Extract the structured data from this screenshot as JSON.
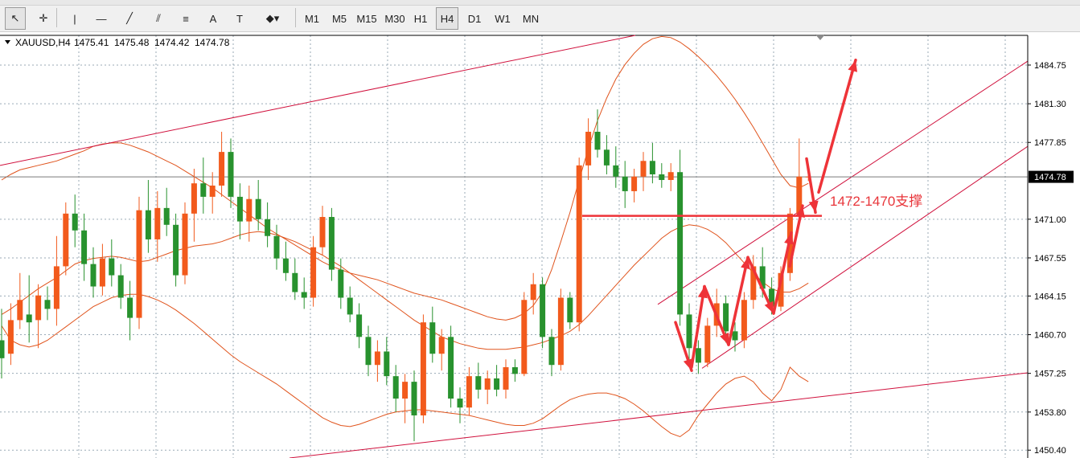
{
  "toolbar": {
    "tools": [
      {
        "name": "cursor-tool",
        "glyph": "↖"
      },
      {
        "name": "crosshair-tool",
        "glyph": "✛"
      },
      {
        "name": "vertical-line-tool",
        "glyph": "|"
      },
      {
        "name": "horizontal-line-tool",
        "glyph": "—"
      },
      {
        "name": "trendline-tool",
        "glyph": "╱"
      },
      {
        "name": "equidistant-channel-tool",
        "glyph": "⫽"
      },
      {
        "name": "fibonacci-tool",
        "glyph": "≡"
      },
      {
        "name": "text-tool",
        "glyph": "A"
      },
      {
        "name": "text-label-tool",
        "glyph": "T"
      },
      {
        "name": "shapes-menu-tool",
        "glyph": "◆▾"
      }
    ],
    "timeframes": [
      "M1",
      "M5",
      "M15",
      "M30",
      "H1",
      "H4",
      "D1",
      "W1",
      "MN"
    ],
    "active_timeframe": "H4"
  },
  "header": {
    "symbol": "XAUUSD,H4",
    "open": "1475.41",
    "high": "1475.48",
    "low": "1474.42",
    "close": "1474.78"
  },
  "colors": {
    "bull": "#f25a1c",
    "bear": "#28922e",
    "band": "#e0541d",
    "channel": "#d0103c",
    "annotation": "#ee3338",
    "grid": "#9aaab6"
  },
  "chart_data": {
    "type": "candlestick",
    "symbol": "XAUUSD",
    "timeframe": "H4",
    "y_tick_labels": [
      "1484.75",
      "1481.30",
      "1477.85",
      "1474.78",
      "1471.00",
      "1467.55",
      "1464.15",
      "1460.70",
      "1457.25",
      "1453.80",
      "1450.40"
    ],
    "ylim": [
      1449.7,
      1487.4
    ],
    "current_price": "1474.78",
    "annotation_text": "1472-1470支撑",
    "support_level": 1471.3,
    "candles": [
      [
        1460.2,
        1463.0,
        1456.8,
        1458.6
      ],
      [
        1459.0,
        1463.5,
        1458.0,
        1462.0
      ],
      [
        1462.0,
        1466.2,
        1461.2,
        1463.8
      ],
      [
        1462.5,
        1466.0,
        1460.0,
        1461.8
      ],
      [
        1462.0,
        1465.2,
        1459.5,
        1464.2
      ],
      [
        1463.8,
        1465.0,
        1462.0,
        1463.0
      ],
      [
        1463.0,
        1469.5,
        1461.5,
        1466.8
      ],
      [
        1466.8,
        1472.5,
        1466.0,
        1471.5
      ],
      [
        1471.5,
        1473.2,
        1468.5,
        1470.0
      ],
      [
        1470.0,
        1471.5,
        1465.5,
        1467.0
      ],
      [
        1467.0,
        1468.5,
        1464.0,
        1465.0
      ],
      [
        1465.0,
        1468.8,
        1464.2,
        1467.5
      ],
      [
        1467.5,
        1469.2,
        1465.0,
        1466.0
      ],
      [
        1466.0,
        1467.0,
        1463.0,
        1464.0
      ],
      [
        1464.0,
        1465.5,
        1460.2,
        1462.2
      ],
      [
        1462.2,
        1473.0,
        1461.2,
        1471.8
      ],
      [
        1471.8,
        1474.5,
        1468.0,
        1469.2
      ],
      [
        1469.2,
        1473.5,
        1467.2,
        1472.0
      ],
      [
        1472.0,
        1473.8,
        1469.5,
        1470.5
      ],
      [
        1470.5,
        1471.5,
        1465.0,
        1466.0
      ],
      [
        1466.0,
        1472.5,
        1465.2,
        1471.5
      ],
      [
        1471.5,
        1475.5,
        1469.0,
        1474.2
      ],
      [
        1474.2,
        1476.5,
        1471.5,
        1473.0
      ],
      [
        1473.0,
        1475.2,
        1471.5,
        1474.0
      ],
      [
        1474.0,
        1478.8,
        1473.0,
        1477.0
      ],
      [
        1477.0,
        1478.2,
        1472.0,
        1473.0
      ],
      [
        1473.0,
        1474.2,
        1469.2,
        1470.8
      ],
      [
        1470.8,
        1474.0,
        1469.0,
        1472.8
      ],
      [
        1472.8,
        1474.5,
        1470.0,
        1471.0
      ],
      [
        1471.0,
        1472.5,
        1468.5,
        1469.5
      ],
      [
        1469.5,
        1470.5,
        1466.5,
        1467.5
      ],
      [
        1467.5,
        1469.0,
        1465.5,
        1466.2
      ],
      [
        1466.2,
        1467.5,
        1463.8,
        1464.5
      ],
      [
        1464.5,
        1465.8,
        1463.0,
        1464.0
      ],
      [
        1464.0,
        1469.5,
        1463.2,
        1468.5
      ],
      [
        1468.5,
        1472.2,
        1467.8,
        1471.2
      ],
      [
        1471.2,
        1472.0,
        1465.5,
        1466.5
      ],
      [
        1466.5,
        1467.5,
        1463.0,
        1464.0
      ],
      [
        1464.0,
        1465.0,
        1461.8,
        1462.5
      ],
      [
        1462.5,
        1463.5,
        1459.5,
        1460.5
      ],
      [
        1460.5,
        1461.5,
        1457.0,
        1458.0
      ],
      [
        1458.0,
        1460.2,
        1456.5,
        1459.2
      ],
      [
        1459.2,
        1460.5,
        1456.2,
        1457.0
      ],
      [
        1457.0,
        1458.0,
        1453.8,
        1455.0
      ],
      [
        1455.0,
        1457.2,
        1452.8,
        1456.5
      ],
      [
        1456.5,
        1457.5,
        1451.2,
        1453.5
      ],
      [
        1453.5,
        1462.5,
        1452.8,
        1461.8
      ],
      [
        1461.8,
        1463.2,
        1458.2,
        1459.0
      ],
      [
        1459.0,
        1461.2,
        1457.5,
        1460.5
      ],
      [
        1460.5,
        1461.5,
        1454.2,
        1455.0
      ],
      [
        1455.0,
        1456.0,
        1452.8,
        1454.2
      ],
      [
        1454.2,
        1457.8,
        1453.5,
        1457.0
      ],
      [
        1457.0,
        1458.2,
        1455.0,
        1455.8
      ],
      [
        1455.8,
        1457.5,
        1454.5,
        1456.8
      ],
      [
        1456.8,
        1458.0,
        1455.2,
        1455.8
      ],
      [
        1455.8,
        1458.5,
        1455.0,
        1457.8
      ],
      [
        1457.8,
        1458.5,
        1456.5,
        1457.2
      ],
      [
        1457.2,
        1464.5,
        1457.0,
        1463.8
      ],
      [
        1463.8,
        1466.2,
        1462.5,
        1465.2
      ],
      [
        1465.2,
        1465.8,
        1459.5,
        1460.5
      ],
      [
        1460.5,
        1461.2,
        1457.0,
        1458.0
      ],
      [
        1458.0,
        1464.8,
        1457.5,
        1464.0
      ],
      [
        1464.0,
        1464.5,
        1461.2,
        1461.8
      ],
      [
        1461.8,
        1476.5,
        1461.0,
        1475.8
      ],
      [
        1475.8,
        1480.0,
        1474.5,
        1478.8
      ],
      [
        1478.8,
        1480.8,
        1476.5,
        1477.2
      ],
      [
        1477.2,
        1478.5,
        1475.0,
        1475.8
      ],
      [
        1475.8,
        1477.5,
        1473.8,
        1474.8
      ],
      [
        1474.8,
        1476.2,
        1472.0,
        1473.5
      ],
      [
        1473.5,
        1475.5,
        1472.5,
        1474.8
      ],
      [
        1474.8,
        1477.0,
        1473.5,
        1476.2
      ],
      [
        1476.2,
        1477.8,
        1474.2,
        1475.0
      ],
      [
        1475.0,
        1476.0,
        1473.8,
        1474.5
      ],
      [
        1474.5,
        1476.0,
        1473.5,
        1475.2
      ],
      [
        1475.2,
        1477.2,
        1461.5,
        1462.5
      ],
      [
        1462.5,
        1463.5,
        1458.5,
        1459.5
      ],
      [
        1459.5,
        1460.2,
        1457.2,
        1458.2
      ],
      [
        1458.2,
        1462.2,
        1457.8,
        1461.5
      ],
      [
        1461.5,
        1464.8,
        1460.5,
        1463.5
      ],
      [
        1463.5,
        1464.2,
        1460.0,
        1461.0
      ],
      [
        1461.0,
        1461.8,
        1459.2,
        1460.2
      ],
      [
        1460.2,
        1464.5,
        1459.5,
        1463.8
      ],
      [
        1463.8,
        1467.8,
        1463.0,
        1466.8
      ],
      [
        1466.8,
        1468.5,
        1464.0,
        1464.8
      ],
      [
        1464.8,
        1465.8,
        1462.5,
        1463.2
      ],
      [
        1463.2,
        1466.8,
        1462.8,
        1466.2
      ],
      [
        1466.2,
        1472.0,
        1465.5,
        1471.5
      ],
      [
        1471.5,
        1478.2,
        1470.8,
        1474.8
      ],
      [
        1474.8,
        1475.5,
        1474.4,
        1474.8
      ]
    ],
    "bollinger_middle": [
      1462.5,
      1463.0,
      1463.6,
      1464.2,
      1464.8,
      1465.3,
      1465.8,
      1466.4,
      1467.0,
      1467.3,
      1467.5,
      1467.6,
      1467.7,
      1467.6,
      1467.4,
      1467.2,
      1467.3,
      1467.6,
      1467.9,
      1468.2,
      1468.4,
      1468.6,
      1468.7,
      1468.8,
      1469.0,
      1469.3,
      1469.6,
      1469.8,
      1469.9,
      1469.8,
      1469.6,
      1469.3,
      1469.0,
      1468.6,
      1468.2,
      1467.8,
      1467.3,
      1466.8,
      1466.2,
      1465.6,
      1465.0,
      1464.4,
      1463.8,
      1463.2,
      1462.6,
      1462.0,
      1461.5,
      1461.0,
      1460.5,
      1460.2,
      1459.9,
      1459.7,
      1459.5,
      1459.4,
      1459.4,
      1459.4,
      1459.5,
      1459.6,
      1459.8,
      1460.0,
      1460.3,
      1460.6,
      1461.0,
      1461.6,
      1462.4,
      1463.3,
      1464.2,
      1465.1,
      1466.0,
      1466.9,
      1467.7,
      1468.5,
      1469.3,
      1469.9,
      1470.3,
      1470.5,
      1470.4,
      1470.1,
      1469.6,
      1468.9,
      1468.0,
      1467.1,
      1466.2,
      1465.4,
      1464.8,
      1464.5,
      1464.5,
      1464.8,
      1465.3
    ],
    "bollinger_upper": [
      1474.5,
      1475.0,
      1475.4,
      1475.6,
      1475.8,
      1476.0,
      1476.2,
      1476.5,
      1476.8,
      1477.1,
      1477.5,
      1477.7,
      1477.8,
      1477.8,
      1477.6,
      1477.3,
      1477.0,
      1476.6,
      1476.2,
      1475.8,
      1475.3,
      1474.8,
      1474.3,
      1473.8,
      1473.2,
      1472.6,
      1472.0,
      1471.4,
      1470.8,
      1470.2,
      1469.7,
      1469.2,
      1468.7,
      1468.2,
      1467.7,
      1467.2,
      1466.8,
      1466.5,
      1466.2,
      1466.0,
      1465.8,
      1465.6,
      1465.3,
      1465.0,
      1464.7,
      1464.4,
      1464.2,
      1464.0,
      1463.8,
      1463.5,
      1463.2,
      1462.9,
      1462.6,
      1462.3,
      1462.1,
      1462.0,
      1462.2,
      1462.6,
      1463.3,
      1464.5,
      1466.5,
      1469.0,
      1471.6,
      1474.5,
      1477.3,
      1479.8,
      1481.8,
      1483.5,
      1484.8,
      1485.8,
      1486.6,
      1487.1,
      1487.3,
      1487.2,
      1486.8,
      1486.2,
      1485.5,
      1484.7,
      1483.8,
      1482.8,
      1481.7,
      1480.5,
      1479.2,
      1477.8,
      1476.4,
      1475.0,
      1474.0,
      1473.8,
      1474.2
    ],
    "bollinger_lower": [
      1461.5,
      1460.2,
      1459.8,
      1459.6,
      1459.8,
      1460.2,
      1460.8,
      1461.4,
      1462.0,
      1462.6,
      1463.2,
      1463.6,
      1464.0,
      1464.2,
      1464.3,
      1464.3,
      1464.1,
      1463.8,
      1463.4,
      1462.9,
      1462.3,
      1461.7,
      1461.0,
      1460.3,
      1459.6,
      1458.9,
      1458.3,
      1457.8,
      1457.3,
      1456.8,
      1456.3,
      1455.7,
      1455.1,
      1454.5,
      1453.9,
      1453.3,
      1452.9,
      1452.6,
      1452.5,
      1452.7,
      1453.0,
      1453.3,
      1453.6,
      1453.8,
      1453.9,
      1454.0,
      1454.0,
      1453.9,
      1453.8,
      1453.7,
      1453.6,
      1453.5,
      1453.3,
      1453.1,
      1452.9,
      1452.7,
      1452.6,
      1452.6,
      1452.8,
      1453.2,
      1453.8,
      1454.4,
      1454.9,
      1455.2,
      1455.4,
      1455.5,
      1455.5,
      1455.3,
      1455.0,
      1454.5,
      1453.9,
      1453.2,
      1452.5,
      1451.9,
      1451.6,
      1452.2,
      1453.5,
      1454.5,
      1455.5,
      1456.3,
      1456.8,
      1457.0,
      1456.5,
      1455.5,
      1454.8,
      1455.8,
      1457.8,
      1457.0,
      1456.5
    ]
  }
}
